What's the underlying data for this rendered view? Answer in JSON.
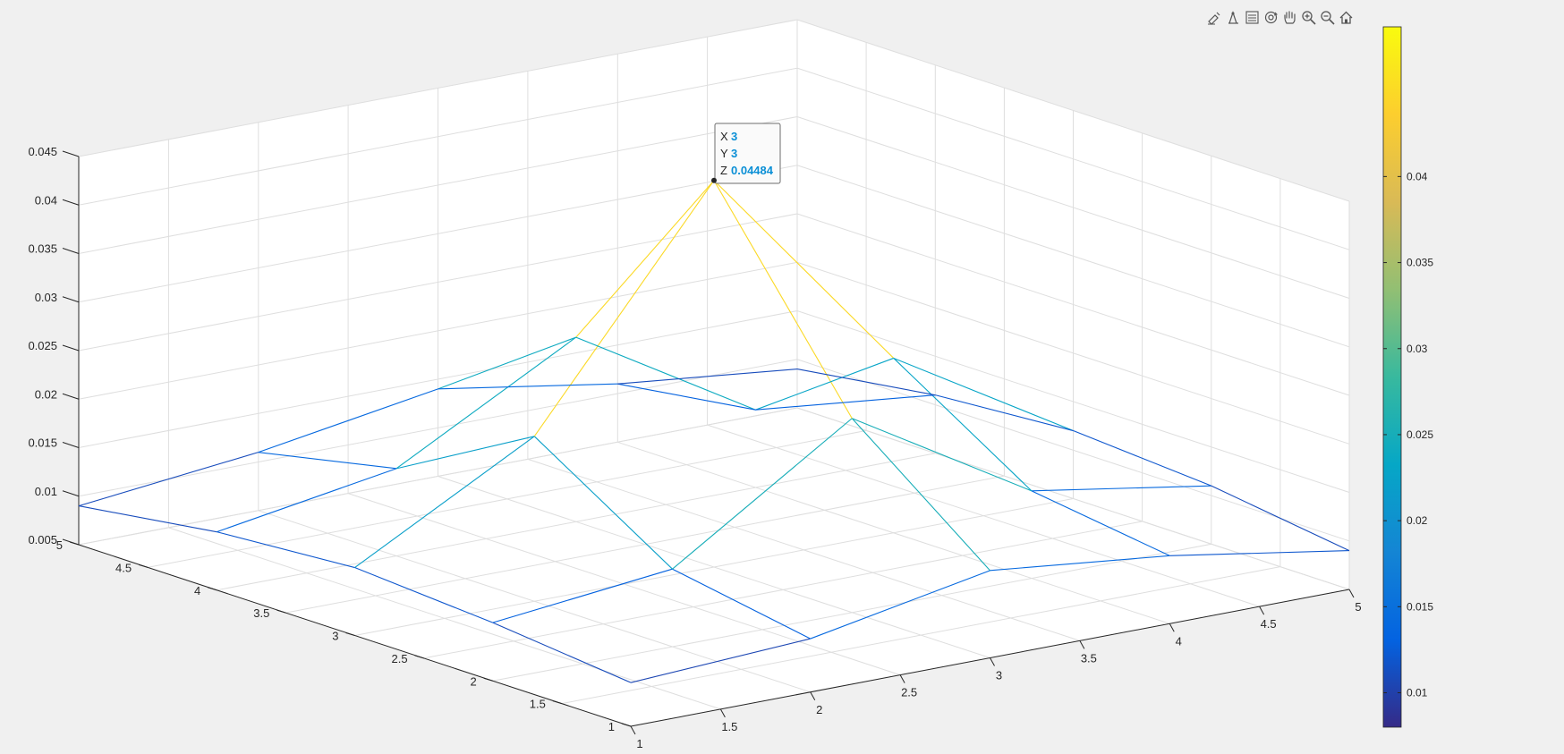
{
  "toolbar": {
    "icons": [
      "brush-icon",
      "data-tips-icon",
      "legend-icon",
      "rotate-3d-icon",
      "pan-hand-icon",
      "zoom-in-icon",
      "zoom-out-icon",
      "home-icon"
    ]
  },
  "colors": {
    "background": "#f0f0f0",
    "axes_face": "#ffffff",
    "grid": "#dedede",
    "axis_line": "#262626",
    "datatip_value": "#0a8fd6",
    "parula": [
      "#352a87",
      "#0363e1",
      "#1485d4",
      "#06a7c6",
      "#38b99e",
      "#92bf73",
      "#d9ba56",
      "#fcce2e",
      "#f9fb0e"
    ]
  },
  "chart_data": {
    "type": "mesh3d",
    "x": [
      1,
      2,
      3,
      4,
      5
    ],
    "y": [
      1,
      2,
      3,
      4,
      5
    ],
    "z": [
      [
        0.0095,
        0.0105,
        0.014,
        0.012,
        0.009
      ],
      [
        0.011,
        0.013,
        0.025,
        0.014,
        0.011
      ],
      [
        0.012,
        0.022,
        0.04484,
        0.023,
        0.012
      ],
      [
        0.011,
        0.014,
        0.024,
        0.013,
        0.011
      ],
      [
        0.009,
        0.011,
        0.014,
        0.011,
        0.009
      ]
    ],
    "xlim": [
      1,
      5
    ],
    "ylim": [
      1,
      5
    ],
    "zlim": [
      0.005,
      0.045
    ],
    "clim": [
      0.008,
      0.0487
    ],
    "grid": true,
    "colormap": "parula",
    "x_ticks": [
      "1",
      "1.5",
      "2",
      "2.5",
      "3",
      "3.5",
      "4",
      "4.5",
      "5"
    ],
    "y_ticks": [
      "1",
      "1.5",
      "2",
      "2.5",
      "3",
      "3.5",
      "4",
      "4.5",
      "5"
    ],
    "z_ticks": [
      "0.005",
      "0.01",
      "0.015",
      "0.02",
      "0.025",
      "0.03",
      "0.035",
      "0.04",
      "0.045"
    ],
    "colorbar_ticks": [
      "0.01",
      "0.015",
      "0.02",
      "0.025",
      "0.03",
      "0.035",
      "0.04"
    ],
    "datatip": {
      "x_label": "X",
      "x_value": "3",
      "y_label": "Y",
      "y_value": "3",
      "z_label": "Z",
      "z_value": "0.04484"
    }
  }
}
